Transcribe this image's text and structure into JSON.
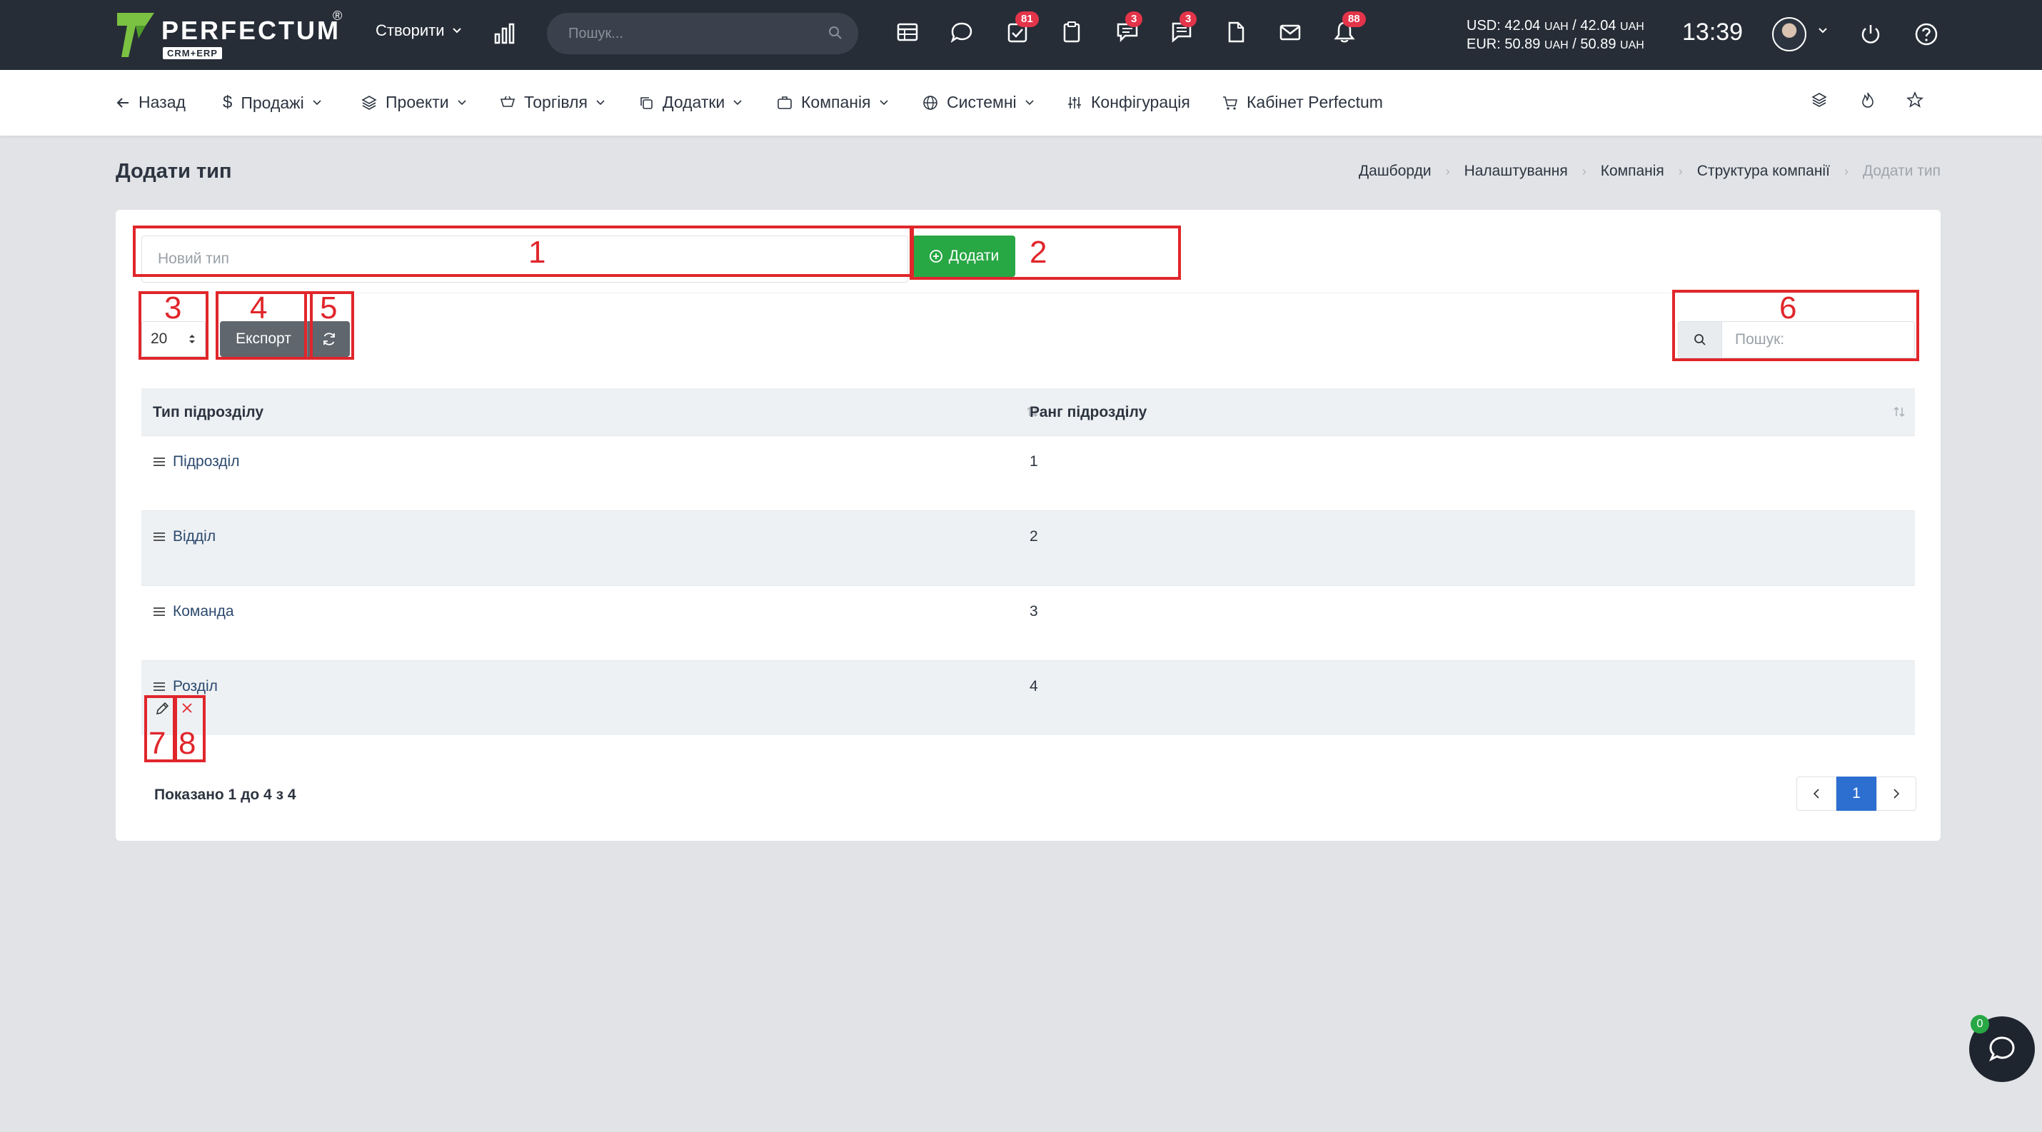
{
  "header": {
    "logo_text": "PERFECTUM",
    "logo_reg": "®",
    "logo_sub": "CRM+ERP",
    "create_label": "Створити",
    "search_placeholder": "Пошук...",
    "badges": {
      "tasks": "81",
      "chat": "3",
      "messages": "3",
      "notifications": "88"
    },
    "rates": {
      "usd": "USD: 42.04",
      "usd_2": "/ 42.04",
      "eur": "EUR: 50.89",
      "eur_2": "/ 50.89",
      "unit": "UAH"
    },
    "clock": "13:39"
  },
  "nav": {
    "back": "Назад",
    "sales": "Продажі",
    "projects": "Проекти",
    "trade": "Торгівля",
    "addons": "Додатки",
    "company": "Компанія",
    "system": "Системні",
    "config": "Конфігурація",
    "cabinet": "Кабінет Perfectum"
  },
  "page": {
    "title": "Додати тип",
    "breadcrumb": [
      "Дашборди",
      "Налаштування",
      "Компанія",
      "Структура компанії",
      "Додати тип"
    ]
  },
  "form": {
    "new_type_placeholder": "Новий тип",
    "add_label": "Додати"
  },
  "table_tools": {
    "page_size": "20",
    "export_label": "Експорт",
    "search_placeholder": "Пошук:"
  },
  "table": {
    "columns": [
      "Тип підрозділу",
      "Ранг підрозділу"
    ],
    "rows": [
      {
        "type": "Підрозділ",
        "rank": "1"
      },
      {
        "type": "Відділ",
        "rank": "2"
      },
      {
        "type": "Команда",
        "rank": "3"
      },
      {
        "type": "Розділ",
        "rank": "4"
      }
    ],
    "info": "Показано 1 до 4 з 4",
    "current_page": "1"
  },
  "annotations": [
    "1",
    "2",
    "3",
    "4",
    "5",
    "6",
    "7",
    "8"
  ],
  "chat": {
    "count": "0"
  },
  "colors": {
    "accent_green": "#28a745",
    "topbar": "#262d37",
    "annotation_red": "#e0262b",
    "pager_active": "#2c6fd1"
  }
}
